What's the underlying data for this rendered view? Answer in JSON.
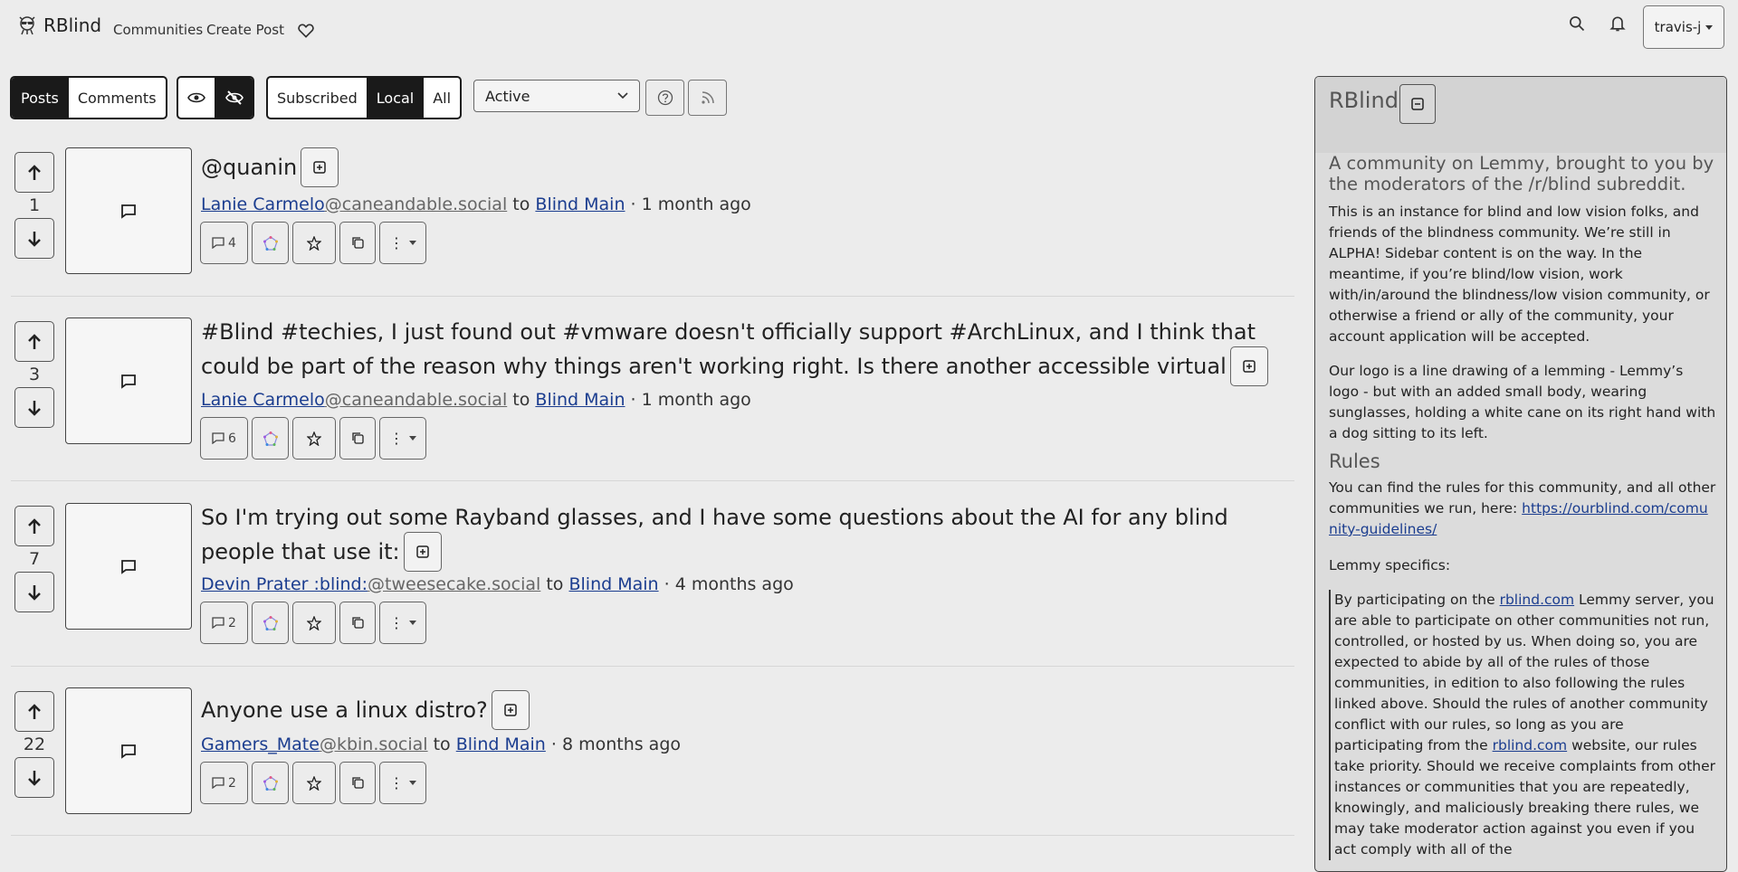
{
  "nav": {
    "brand": "RBlind",
    "links": [
      "Communities",
      "Create Post"
    ],
    "user": "travis-j"
  },
  "toolbar": {
    "view_toggle": [
      "Posts",
      "Comments"
    ],
    "listing": [
      "Subscribed",
      "Local",
      "All"
    ],
    "sort": "Active"
  },
  "posts": [
    {
      "votes": "1",
      "title": "@quanin",
      "author": "Lanie Carmelo",
      "instance": "@caneandable.social",
      "to": "to",
      "community": "Blind Main",
      "time": "· 1 month ago",
      "comments": "4"
    },
    {
      "votes": "3",
      "title": "#Blind #techies, I just found out #vmware doesn't officially support #ArchLinux, and I think that could be part of the reason why things aren't working right. Is there another accessible virtual",
      "author": "Lanie Carmelo",
      "instance": "@caneandable.social",
      "to": "to",
      "community": "Blind Main",
      "time": "· 1 month ago",
      "comments": "6"
    },
    {
      "votes": "7",
      "title": "So I'm trying out some Rayband glasses, and I have some questions about the AI for any blind people that use it:",
      "author": "Devin Prater :blind:",
      "instance": "@tweesecake.social",
      "to": "to",
      "community": "Blind Main",
      "time": "· 4 months ago",
      "comments": "2"
    },
    {
      "votes": "22",
      "title": "Anyone use a linux distro?",
      "author": "Gamers_Mate",
      "instance": "@kbin.social",
      "to": "to",
      "community": "Blind Main",
      "time": "· 8 months ago",
      "comments": "2"
    }
  ],
  "sidebar": {
    "title": "RBlind",
    "tagline": "A community on Lemmy, brought to you by the moderators of the /r/blind subreddit.",
    "p1": "This is an instance for blind and low vision folks, and friends of the blindness community. We’re still in ALPHA! Sidebar content is on the way. In the meantime, if you’re blind/low vision, work with/in/around the blindness/low vision community, or otherwise a friend or ally of the community, your account application will be accepted.",
    "p2": "Our logo is a line drawing of a lemming - Lemmy’s logo - but with an added small body, wearing sunglasses, holding a white cane on its right hand with a dog sitting to its left.",
    "rules_heading": "Rules",
    "rules_text": "You can find the rules for this community, and all other communities we run, here: ",
    "rules_link": "https://ourblind.com/comunity-guidelines/",
    "lemmy_specifics": "Lemmy specifics:",
    "bq_1": "By participating on the ",
    "bq_link1": "rblind.com",
    "bq_2": " Lemmy server, you are able to participate on other communities not run, controlled, or hosted by us. When doing so, you are expected to abide by all of the rules of those communities, in edition to also following the rules linked above. Should the rules of another community conflict with our rules, so long as you are participating from the ",
    "bq_link2": "rblind.com",
    "bq_3": " website, our rules take priority. Should we receive complaints from other instances or communities that you are repeatedly, knowingly, and maliciously breaking there rules, we may take moderator action against you even if you act comply with all of the"
  }
}
